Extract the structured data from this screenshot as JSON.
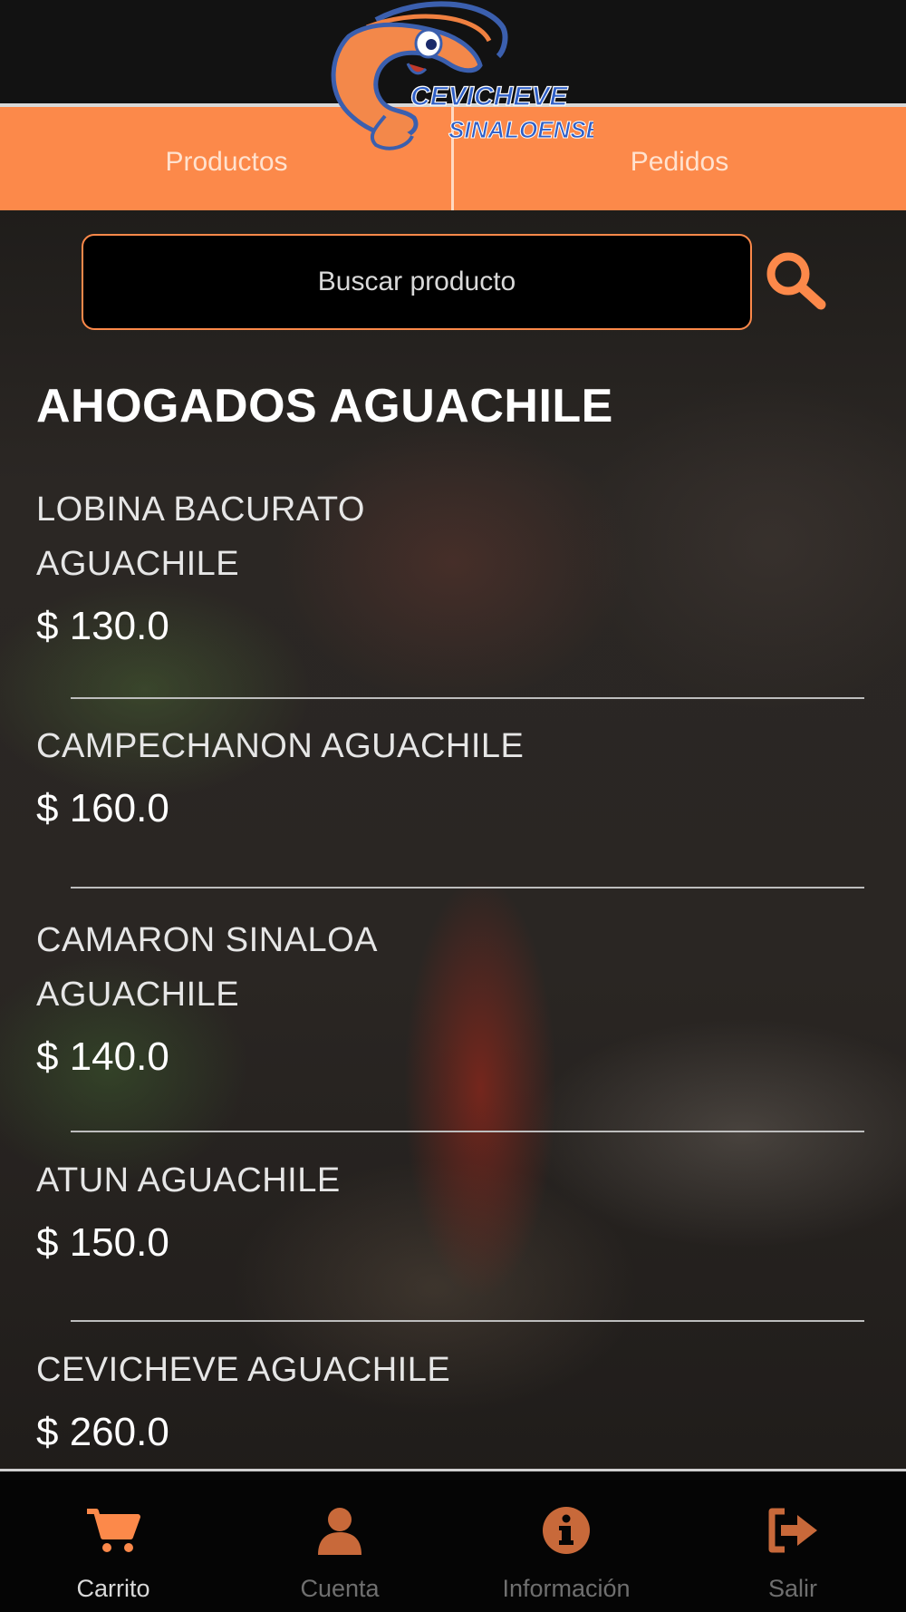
{
  "colors": {
    "accent": "#fc894a",
    "header_bg": "#121212",
    "nav_bg": "#050505"
  },
  "header": {
    "logo_text_line1": "CEVICHEVE",
    "logo_text_line2": "SINALOENSE",
    "tabs": [
      {
        "label": "Productos"
      },
      {
        "label": "Pedidos"
      }
    ]
  },
  "search": {
    "placeholder": "Buscar producto",
    "icon": "search-icon"
  },
  "category": {
    "title": "AHOGADOS AGUACHILE"
  },
  "products": [
    {
      "name": "LOBINA BACURATO AGUACHILE",
      "price": "$ 130.0"
    },
    {
      "name": "CAMPECHANON AGUACHILE",
      "price": "$ 160.0"
    },
    {
      "name": "CAMARON SINALOA AGUACHILE",
      "price": "$ 140.0"
    },
    {
      "name": "ATUN AGUACHILE",
      "price": "$ 150.0"
    },
    {
      "name": "CEVICHEVE AGUACHILE",
      "price": "$ 260.0"
    }
  ],
  "bottom_nav": [
    {
      "label": "Carrito",
      "icon": "cart-icon",
      "active": true
    },
    {
      "label": "Cuenta",
      "icon": "user-icon",
      "active": false
    },
    {
      "label": "Información",
      "icon": "info-icon",
      "active": false
    },
    {
      "label": "Salir",
      "icon": "sign-out-icon",
      "active": false
    }
  ]
}
